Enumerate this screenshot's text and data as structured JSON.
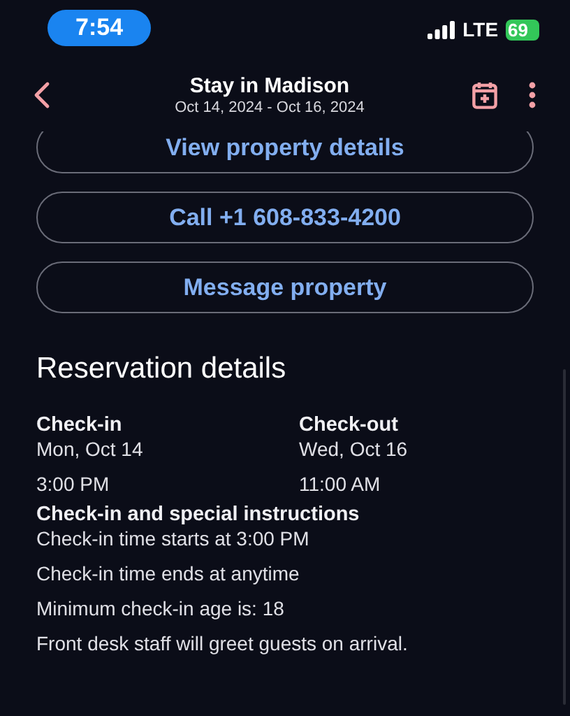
{
  "status_bar": {
    "time": "7:54",
    "network": "LTE",
    "battery": "69"
  },
  "header": {
    "title": "Stay in Madison",
    "subtitle": "Oct 14, 2024 - Oct 16, 2024"
  },
  "actions": [
    "View property details",
    "Call +1 608-833-4200",
    "Message property"
  ],
  "reservation": {
    "heading": "Reservation details",
    "columns": [
      {
        "label": "Check-in",
        "date": "Mon, Oct 14",
        "time": "3:00 PM"
      },
      {
        "label": "Check-out",
        "date": "Wed, Oct 16",
        "time": "11:00 AM"
      }
    ],
    "instructions_heading": "Check-in and special instructions",
    "instructions": [
      "Check-in time starts at 3:00 PM",
      "Check-in time ends at anytime",
      "Minimum check-in age is: 18",
      "Front desk staff will greet guests on arrival."
    ]
  }
}
